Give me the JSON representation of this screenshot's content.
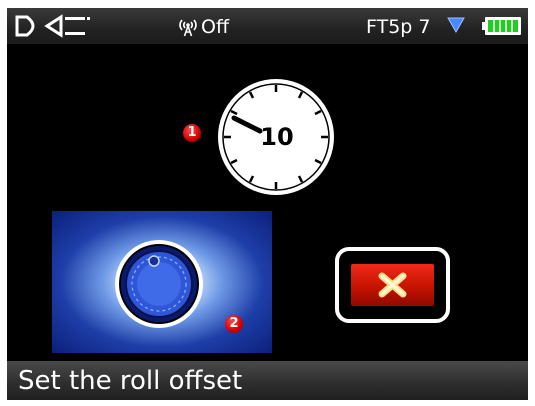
{
  "status_bar": {
    "logo_text": "DCI",
    "radio_status": "Off",
    "radio_icon": "antenna-icon",
    "frequency_label": "FT5p 7",
    "signal_icon": "signal-strength-icon",
    "battery_icon": "battery-icon",
    "battery_level": 1.0
  },
  "roll_gauge": {
    "value": "10",
    "callout": "1"
  },
  "set_roll_button": {
    "icon": "roll-knob-icon",
    "callout": "2"
  },
  "cancel_button": {
    "icon": "close-x-icon"
  },
  "footer": {
    "instruction": "Set the roll offset"
  },
  "colors": {
    "screen_bg": "#000000",
    "callout_red": "#d00000",
    "cancel_red": "#c51200",
    "cancel_x": "#ffe08a",
    "set_button_blue": "#1e3ea8",
    "battery_green": "#22cc22"
  }
}
